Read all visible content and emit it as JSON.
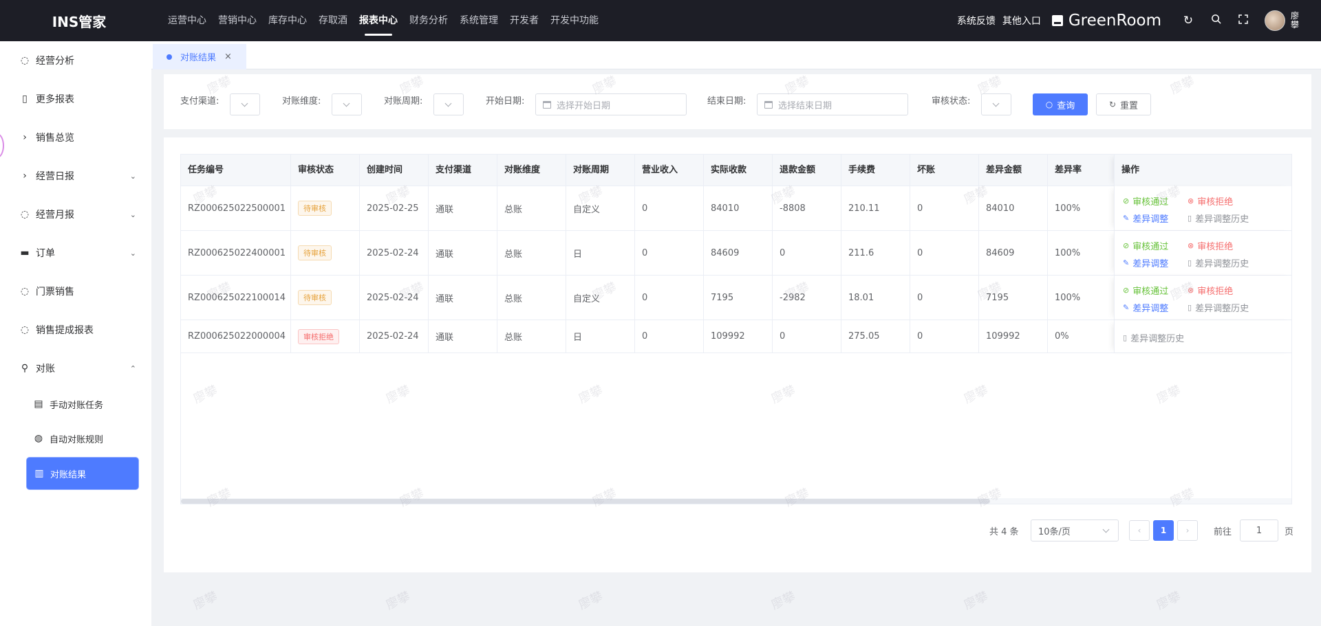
{
  "app": {
    "title": "INS管家"
  },
  "topnav": [
    "运营中心",
    "营销中心",
    "库存中心",
    "存取酒",
    "报表中心",
    "财务分析",
    "系统管理",
    "开发者",
    "开发中功能"
  ],
  "topnav_active": "报表中心",
  "header": {
    "feedback": "系统反馈",
    "other_entry": "其他入口",
    "store_name": "GreenRoom",
    "user_name": "廖攀"
  },
  "sidebar": {
    "items": [
      {
        "label": "经营分析",
        "icon": "dashboard-icon"
      },
      {
        "label": "更多报表",
        "icon": "report-icon"
      },
      {
        "label": "销售总览",
        "icon": "chevron-right-icon"
      },
      {
        "label": "经营日报",
        "icon": "chevron-right-icon",
        "chevron": "down"
      },
      {
        "label": "经营月报",
        "icon": "dashboard-icon",
        "chevron": "down"
      },
      {
        "label": "订单",
        "icon": "order-icon",
        "chevron": "down"
      },
      {
        "label": "门票销售",
        "icon": "dashboard-icon"
      },
      {
        "label": "销售提成报表",
        "icon": "dashboard-icon"
      },
      {
        "label": "对账",
        "icon": "location-icon",
        "chevron": "up"
      }
    ],
    "sub_items": [
      {
        "label": "手动对账任务",
        "icon": "clipboard-icon"
      },
      {
        "label": "自动对账规则",
        "icon": "pause-icon"
      },
      {
        "label": "对账结果",
        "icon": "book-icon",
        "active": true
      }
    ]
  },
  "tabs": [
    {
      "label": "对账结果",
      "close": "×"
    }
  ],
  "filters": {
    "pay_channel": "支付渠道:",
    "dimension": "对账维度:",
    "period": "对账周期:",
    "start_date": "开始日期:",
    "start_placeholder": "选择开始日期",
    "end_date": "结束日期:",
    "end_placeholder": "选择结束日期",
    "review_status": "审核状态:",
    "query_btn": "查询",
    "reset_btn": "重置"
  },
  "table": {
    "columns": [
      "任务编号",
      "审核状态",
      "创建时间",
      "支付渠道",
      "对账维度",
      "对账周期",
      "营业收入",
      "实际收款",
      "退款金额",
      "手续费",
      "坏账",
      "差异金额",
      "差异率",
      "操作"
    ],
    "rows": [
      {
        "id": "RZ000625022500001",
        "status": "待审核",
        "status_type": "pending",
        "created": "2025-02-25",
        "channel": "通联",
        "dimension": "总账",
        "period": "自定义",
        "revenue": "0",
        "received": "84010",
        "refund": "-8808",
        "fee": "210.11",
        "bad_debt": "0",
        "diff": "84010",
        "diff_rate": "100%"
      },
      {
        "id": "RZ000625022400001",
        "status": "待审核",
        "status_type": "pending",
        "created": "2025-02-24",
        "channel": "通联",
        "dimension": "总账",
        "period": "日",
        "revenue": "0",
        "received": "84609",
        "refund": "0",
        "fee": "211.6",
        "bad_debt": "0",
        "diff": "84609",
        "diff_rate": "100%"
      },
      {
        "id": "RZ000625022100014",
        "status": "待审核",
        "status_type": "pending",
        "created": "2025-02-24",
        "channel": "通联",
        "dimension": "总账",
        "period": "自定义",
        "revenue": "0",
        "received": "7195",
        "refund": "-2982",
        "fee": "18.01",
        "bad_debt": "0",
        "diff": "7195",
        "diff_rate": "100%"
      },
      {
        "id": "RZ000625022000004",
        "status": "审核拒绝",
        "status_type": "rejected",
        "created": "2025-02-24",
        "channel": "通联",
        "dimension": "总账",
        "period": "日",
        "revenue": "0",
        "received": "109992",
        "refund": "0",
        "fee": "275.05",
        "bad_debt": "0",
        "diff": "109992",
        "diff_rate": "0%"
      }
    ],
    "ops": {
      "approve": "审核通过",
      "reject": "审核拒绝",
      "adjust": "差异调整",
      "history": "差异调整历史"
    }
  },
  "pagination": {
    "total": "共 4 条",
    "page_size": "10条/页",
    "current": "1",
    "goto_prefix": "前往",
    "goto_value": "1",
    "goto_suffix": "页"
  },
  "watermark": "廖攀",
  "colors": {
    "primary": "#4e7bff",
    "topbar": "#1d1e26",
    "success": "#67c23a",
    "danger": "#f56c6c",
    "warning": "#e6a23c"
  }
}
